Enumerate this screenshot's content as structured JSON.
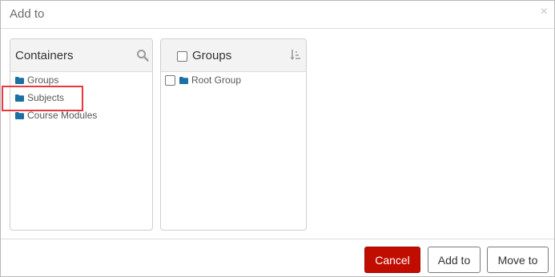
{
  "dialog": {
    "title": "Add to",
    "close_symbol": "×"
  },
  "containers_panel": {
    "title": "Containers",
    "search_icon": "search-icon",
    "items": [
      {
        "label": "Groups",
        "icon": "folder-icon"
      },
      {
        "label": "Subjects",
        "icon": "folder-icon",
        "highlighted": true
      },
      {
        "label": "Course Modules",
        "icon": "folder-icon"
      }
    ]
  },
  "groups_panel": {
    "title": "Groups",
    "select_all_checked": false,
    "sort_icon": "sort-descending-icon",
    "items": [
      {
        "label": "Root Group",
        "icon": "folder-icon",
        "checked": false
      }
    ]
  },
  "footer": {
    "cancel_label": "Cancel",
    "add_to_label": "Add to",
    "move_to_label": "Move to"
  },
  "colors": {
    "folder": "#1a6fa3",
    "cancel_bg": "#c00d00",
    "highlight": "#e8383d"
  }
}
